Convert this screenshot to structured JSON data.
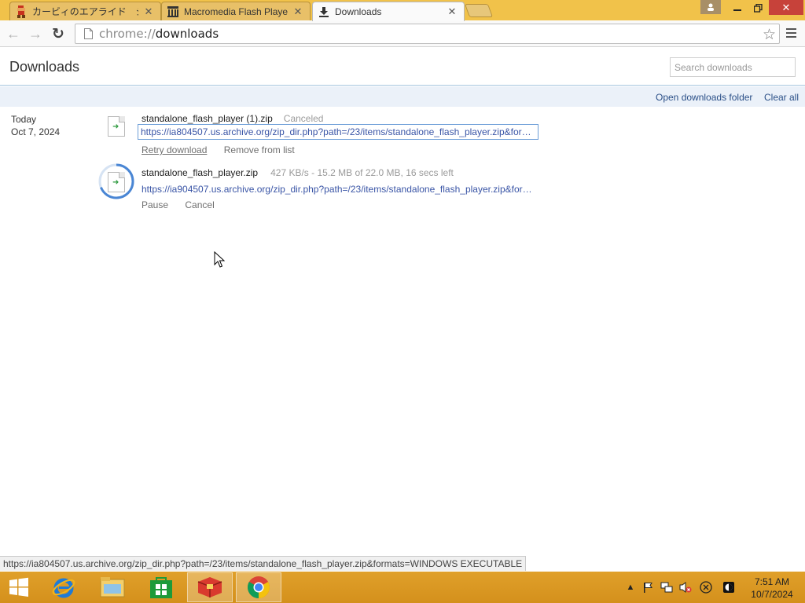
{
  "tabs": [
    {
      "title": "カービィのエアライド　ジグソー",
      "icon": "mario-sprite-icon"
    },
    {
      "title": "Macromedia Flash Player",
      "icon": "archive-building-icon"
    },
    {
      "title": "Downloads",
      "icon": "download-icon"
    }
  ],
  "omnibox": {
    "scheme": "chrome://",
    "path": "downloads"
  },
  "page": {
    "title": "Downloads",
    "search_placeholder": "Search downloads",
    "open_folder_label": "Open downloads folder",
    "clear_all_label": "Clear all"
  },
  "date_group": {
    "day": "Today",
    "date": "Oct 7, 2024"
  },
  "downloads": [
    {
      "name": "standalone_flash_player (1).zip",
      "status": "Canceled",
      "url": "https://ia804507.us.archive.org/zip_dir.php?path=/23/items/standalone_flash_player.zip&form...",
      "actions": [
        "Retry download",
        "Remove from list"
      ]
    },
    {
      "name": "standalone_flash_player.zip",
      "status": "427 KB/s - 15.2 MB of 22.0 MB, 16 secs left",
      "url": "https://ia904507.us.archive.org/zip_dir.php?path=/23/items/standalone_flash_player.zip&form...",
      "actions": [
        "Pause",
        "Cancel"
      ],
      "progress": 0.69
    }
  ],
  "status_bubble": "https://ia804507.us.archive.org/zip_dir.php?path=/23/items/standalone_flash_player.zip&formats=WINDOWS EXECUTABLE",
  "taskbar": {
    "apps": [
      "start",
      "internet-explorer",
      "file-explorer",
      "windows-store",
      "game",
      "chrome"
    ],
    "clock_time": "7:51 AM",
    "clock_date": "10/7/2024"
  },
  "colors": {
    "tabstrip": "#f1c24a",
    "taskbar": "#d8961f",
    "link": "#2a4f87",
    "url": "#3a55a6"
  }
}
